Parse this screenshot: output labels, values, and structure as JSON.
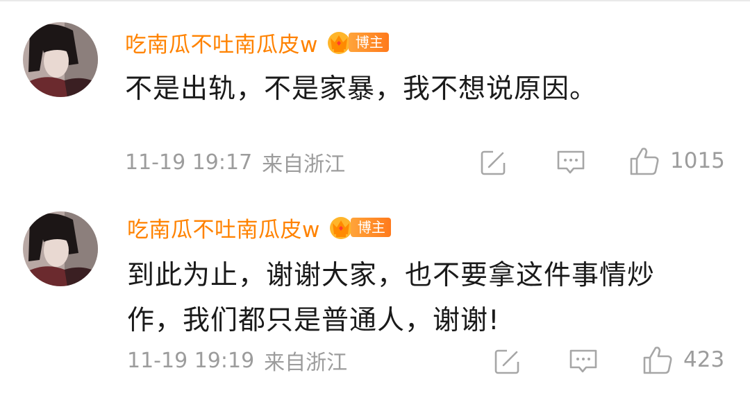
{
  "colors": {
    "username": "#ff8200",
    "badge_bg": "#ff8c2a",
    "text": "#1a1a1a",
    "meta": "#9c9c9c"
  },
  "comments": [
    {
      "username": "吃南瓜不吐南瓜皮w",
      "badge": "博主",
      "text_lines": [
        "不是出轨，不是家暴，我不想说原因。"
      ],
      "date_time": "11-19 19:17",
      "location": "来自浙江",
      "likes": "1015",
      "icons": [
        "avatar",
        "crown-badge-icon",
        "share-icon",
        "comment-icon",
        "like-icon"
      ]
    },
    {
      "username": "吃南瓜不吐南瓜皮w",
      "badge": "博主",
      "text_lines": [
        "到此为止，谢谢大家，也不要拿这件事情炒",
        "作，我们都只是普通人，谢谢!"
      ],
      "date_time": "11-19 19:19",
      "location": "来自浙江",
      "likes": "423",
      "icons": [
        "avatar",
        "crown-badge-icon",
        "share-icon",
        "comment-icon",
        "like-icon"
      ]
    }
  ]
}
